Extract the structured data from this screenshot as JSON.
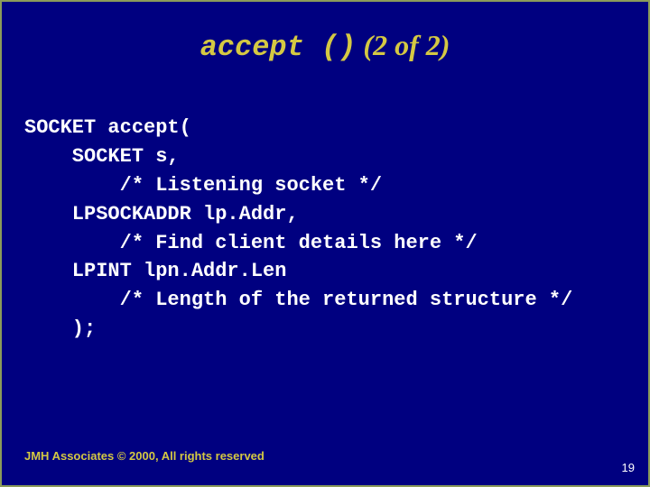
{
  "title": {
    "code_part": "accept ()",
    "rest": " (2 of 2)"
  },
  "code": {
    "l0": "SOCKET accept(",
    "l1": "    SOCKET s,",
    "l2": "        /* Listening socket */",
    "l3": "    LPSOCKADDR lp.Addr,",
    "l4": "        /* Find client details here */",
    "l5": "    LPINT lpn.Addr.Len",
    "l6": "        /* Length of the returned structure */",
    "l7": "    );"
  },
  "footer": "JMH Associates © 2000, All rights reserved",
  "page_number": "19"
}
